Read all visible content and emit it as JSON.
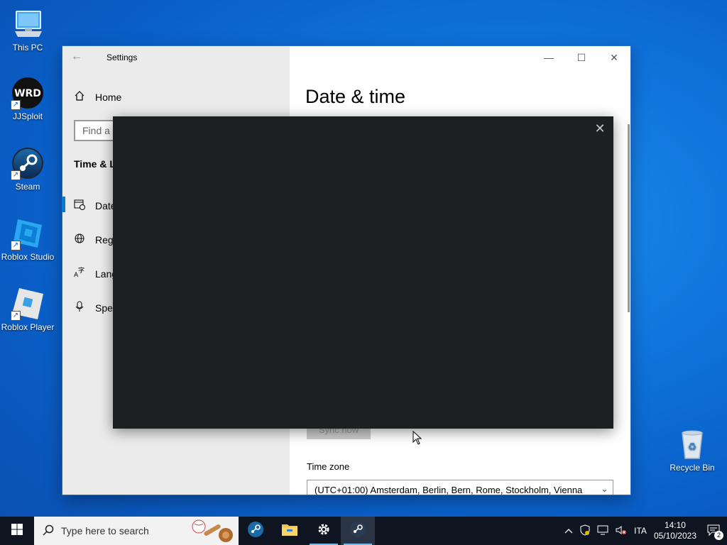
{
  "desktop_icons": [
    {
      "label": "This PC",
      "icon": "computer-icon"
    },
    {
      "label": "JJSploit",
      "icon": "jjsploit-icon"
    },
    {
      "label": "Steam",
      "icon": "steam-icon"
    },
    {
      "label": "Roblox Studio",
      "icon": "roblox-studio-icon"
    },
    {
      "label": "Roblox Player",
      "icon": "roblox-player-icon"
    }
  ],
  "recycle_bin": {
    "label": "Recycle Bin",
    "icon": "recycle-bin-icon"
  },
  "settings": {
    "window_title": "Settings",
    "nav": {
      "home": "Home",
      "search_placeholder": "Find a s",
      "section_heading": "Time & L",
      "items": [
        {
          "label": "Date",
          "icon": "calendar-clock-icon"
        },
        {
          "label": "Reg",
          "icon": "globe-icon"
        },
        {
          "label": "Lang",
          "icon": "language-icon"
        },
        {
          "label": "Spe",
          "icon": "microphone-icon"
        }
      ]
    },
    "main": {
      "page_title": "Date & time",
      "sync_button": "Sync now",
      "time_zone_label": "Time zone",
      "time_zone_value": "(UTC+01:00) Amsterdam, Berlin, Bern, Rome, Stockholm, Vienna"
    }
  },
  "taskbar": {
    "search_placeholder": "Type here to search",
    "apps": [
      "steam-icon",
      "file-explorer-icon",
      "settings-gear-icon",
      "steam-icon"
    ],
    "tray": {
      "language": "ITA",
      "time": "14:10",
      "date": "05/10/2023",
      "notifications_count": "2"
    }
  },
  "colors": {
    "accent": "#0078d4",
    "overlay_bg": "#1e1f22",
    "taskbar_bg": "#0e1520"
  }
}
